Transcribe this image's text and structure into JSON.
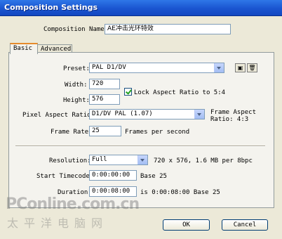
{
  "window": {
    "title": "Composition Settings"
  },
  "composition_name": {
    "label": "Composition Name:",
    "value": "AE冲击光环特效"
  },
  "tabs": [
    {
      "label": "Basic",
      "active": true
    },
    {
      "label": "Advanced",
      "active": false
    }
  ],
  "basic": {
    "preset": {
      "label": "Preset:",
      "value": "PAL D1/DV",
      "icons": [
        "save-preset-icon",
        "delete-preset-icon"
      ]
    },
    "width": {
      "label": "Width:",
      "value": "720"
    },
    "height": {
      "label": "Height:",
      "value": "576"
    },
    "lock_aspect": {
      "label": "Lock Aspect Ratio to 5:4",
      "checked": true
    },
    "pixel_aspect": {
      "label": "Pixel Aspect Ratio:",
      "value": "D1/DV PAL (1.07)"
    },
    "frame_aspect": {
      "line1": "Frame Aspect",
      "line2": "Ratio: 4:3"
    },
    "frame_rate": {
      "label": "Frame Rate:",
      "value": "25",
      "unit": "Frames per second"
    },
    "resolution": {
      "label": "Resolution:",
      "value": "Full",
      "info": "720 x 576, 1.6 MB per 8bpc"
    },
    "start_timecode": {
      "label": "Start Timecode:",
      "value": "0:00:00:00",
      "base": "Base 25"
    },
    "duration": {
      "label": "Duration:",
      "value": "0:00:08:00",
      "info": "is 0:00:08:00  Base 25"
    }
  },
  "buttons": {
    "ok": "OK",
    "cancel": "Cancel"
  },
  "watermark": {
    "line1": "PConline.com.cn",
    "line2": "太平洋电脑网"
  },
  "colors": {
    "titlebar": "#1a55d0",
    "dialog": "#ece9d8",
    "tab_highlight": "#e68b2c"
  }
}
